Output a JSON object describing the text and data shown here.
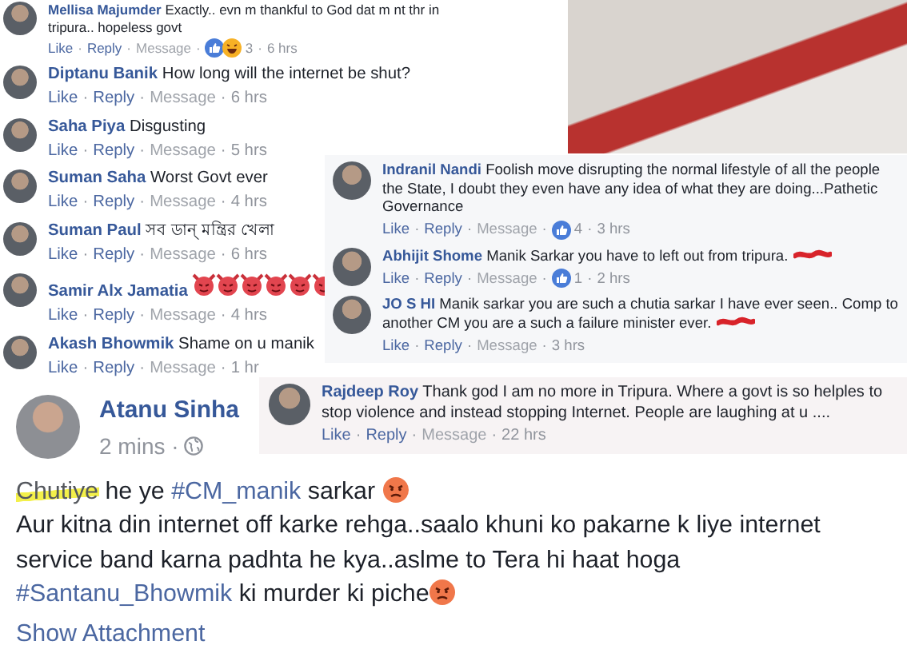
{
  "panels": [
    {
      "kind": "column",
      "comments": [
        {
          "kind": "compact",
          "name": "Mellisa Majumder",
          "text": "Exactly.. evn m thankful to God dat m nt thr in tripura.. hopeless govt",
          "redacted": false,
          "footer": [
            {
              "kind": "link",
              "text": "Like"
            },
            {
              "kind": "sep",
              "text": "·"
            },
            {
              "kind": "link",
              "text": "Reply"
            },
            {
              "kind": "sep",
              "text": "·"
            },
            {
              "kind": "muted",
              "text": "Message"
            },
            {
              "kind": "sep",
              "text": "·"
            },
            {
              "kind": "reaction",
              "haha": true,
              "text": "3"
            },
            {
              "kind": "sep",
              "text": "·"
            },
            {
              "kind": "time",
              "text": "6 hrs"
            }
          ]
        },
        {
          "kind": "normal",
          "name": "Diptanu Banik",
          "text": "How long will the internet be shut?",
          "redacted": false,
          "footer": [
            {
              "kind": "link",
              "text": "Like"
            },
            {
              "kind": "sep",
              "text": "·"
            },
            {
              "kind": "link",
              "text": "Reply"
            },
            {
              "kind": "sep",
              "text": "·"
            },
            {
              "kind": "muted",
              "text": "Message"
            },
            {
              "kind": "sep",
              "text": "·"
            },
            {
              "kind": "time",
              "text": "6 hrs"
            }
          ]
        },
        {
          "kind": "normal",
          "name": "Saha Piya",
          "text": "Disgusting",
          "redacted": false,
          "footer": [
            {
              "kind": "link",
              "text": "Like"
            },
            {
              "kind": "sep",
              "text": "·"
            },
            {
              "kind": "link",
              "text": "Reply"
            },
            {
              "kind": "sep",
              "text": "·"
            },
            {
              "kind": "muted",
              "text": "Message"
            },
            {
              "kind": "sep",
              "text": "·"
            },
            {
              "kind": "time",
              "text": "5 hrs"
            }
          ]
        },
        {
          "kind": "normal",
          "name": "Suman Saha",
          "text": "Worst Govt ever",
          "redacted": false,
          "footer": [
            {
              "kind": "link",
              "text": "Like"
            },
            {
              "kind": "sep",
              "text": "·"
            },
            {
              "kind": "link",
              "text": "Reply"
            },
            {
              "kind": "sep",
              "text": "·"
            },
            {
              "kind": "muted",
              "text": "Message"
            },
            {
              "kind": "sep",
              "text": "·"
            },
            {
              "kind": "time",
              "text": "4 hrs"
            }
          ]
        },
        {
          "kind": "normal",
          "name": "Suman Paul",
          "text": "সব ডান্ মন্ত্রির খেলা",
          "redacted": false,
          "footer": [
            {
              "kind": "link",
              "text": "Like"
            },
            {
              "kind": "sep",
              "text": "·"
            },
            {
              "kind": "link",
              "text": "Reply"
            },
            {
              "kind": "sep",
              "text": "·"
            },
            {
              "kind": "muted",
              "text": "Message"
            },
            {
              "kind": "sep",
              "text": "·"
            },
            {
              "kind": "time",
              "text": "6 hrs"
            }
          ]
        },
        {
          "kind": "devil_emojis",
          "name": "Samir Alx Jamatia",
          "redacted": false,
          "footer": [
            {
              "kind": "link",
              "text": "Like"
            },
            {
              "kind": "sep",
              "text": "·"
            },
            {
              "kind": "link",
              "text": "Reply"
            },
            {
              "kind": "sep",
              "text": "·"
            },
            {
              "kind": "muted",
              "text": "Message"
            },
            {
              "kind": "sep",
              "text": "·"
            },
            {
              "kind": "time",
              "text": "4 hrs"
            }
          ]
        },
        {
          "kind": "normal",
          "name": "Akash Bhowmik",
          "text": "Shame on u manik",
          "redacted": false,
          "footer": [
            {
              "kind": "link",
              "text": "Like"
            },
            {
              "kind": "sep",
              "text": "·"
            },
            {
              "kind": "link",
              "text": "Reply"
            },
            {
              "kind": "sep",
              "text": "·"
            },
            {
              "kind": "muted",
              "text": "Message"
            },
            {
              "kind": "sep",
              "text": "·"
            },
            {
              "kind": "time",
              "text": "1 hr"
            }
          ]
        }
      ]
    },
    {
      "kind": "overlay",
      "comments": [
        {
          "kind": "normal",
          "name": "Indranil Nandi",
          "text": "Foolish move disrupting the normal lifestyle of all the people the State, I doubt they even have any idea of what they are doing...Pathetic Governance",
          "redacted": false,
          "footer": [
            {
              "kind": "link",
              "text": "Like"
            },
            {
              "kind": "sep",
              "text": "·"
            },
            {
              "kind": "link",
              "text": "Reply"
            },
            {
              "kind": "sep",
              "text": "·"
            },
            {
              "kind": "muted",
              "text": "Message"
            },
            {
              "kind": "sep",
              "text": "·"
            },
            {
              "kind": "reaction",
              "haha": false,
              "text": "4"
            },
            {
              "kind": "sep",
              "text": "·"
            },
            {
              "kind": "time",
              "text": "3 hrs"
            }
          ]
        },
        {
          "kind": "normal",
          "name": "Abhijit Shome",
          "text": "Manik Sarkar you have to left out from tripura.",
          "redacted": true,
          "footer": [
            {
              "kind": "link",
              "text": "Like"
            },
            {
              "kind": "sep",
              "text": "·"
            },
            {
              "kind": "link",
              "text": "Reply"
            },
            {
              "kind": "sep",
              "text": "·"
            },
            {
              "kind": "muted",
              "text": "Message"
            },
            {
              "kind": "sep",
              "text": "·"
            },
            {
              "kind": "reaction",
              "haha": false,
              "text": "1"
            },
            {
              "kind": "sep",
              "text": "·"
            },
            {
              "kind": "time",
              "text": "2 hrs"
            }
          ]
        },
        {
          "kind": "normal",
          "name": "JO S HI",
          "text": "Manik sarkar you are such a chutia sarkar I have ever seen.. Comp to another CM you are a such a failure minister ever.",
          "redacted": true,
          "footer": [
            {
              "kind": "link",
              "text": "Like"
            },
            {
              "kind": "sep",
              "text": "·"
            },
            {
              "kind": "link",
              "text": "Reply"
            },
            {
              "kind": "sep",
              "text": "·"
            },
            {
              "kind": "muted",
              "text": "Message"
            },
            {
              "kind": "sep",
              "text": "·"
            },
            {
              "kind": "time",
              "text": "3 hrs"
            }
          ]
        }
      ]
    },
    {
      "kind": "strip",
      "comments": [
        {
          "kind": "normal",
          "name": "Rajdeep Roy",
          "text": "Thank god I am no more in Tripura. Where a govt is so helples to stop violence and instead stopping Internet. People are laughing at u ....",
          "redacted": false,
          "footer": [
            {
              "kind": "link",
              "text": "Like"
            },
            {
              "kind": "sep",
              "text": "·"
            },
            {
              "kind": "link",
              "text": "Reply"
            },
            {
              "kind": "sep",
              "text": "·"
            },
            {
              "kind": "muted",
              "text": "Message"
            },
            {
              "kind": "sep",
              "text": "·"
            },
            {
              "kind": "time",
              "text": "22 hrs"
            }
          ]
        }
      ]
    }
  ],
  "post": {
    "author": "Atanu Sinha",
    "time": "2 mins ·",
    "paragraphs": [
      [
        {
          "kind": "scribbled",
          "text": "Chutiye"
        },
        {
          "kind": "plain",
          "text": " he ye "
        },
        {
          "kind": "hashtag",
          "text": "#CM_manik"
        },
        {
          "kind": "plain",
          "text": " sarkar "
        },
        {
          "kind": "emoji"
        }
      ],
      [
        {
          "kind": "plain",
          "text": "Aur kitna din internet off karke rehga..saalo khuni ko pakarne k liye internet service band karna padhta he kya..aslme to Tera hi haat hoga"
        }
      ],
      [
        {
          "kind": "hashtag",
          "text": "#Santanu_Bhowmik"
        },
        {
          "kind": "plain",
          "text": " ki murder ki piche"
        },
        {
          "kind": "emoji"
        }
      ]
    ],
    "attachment_link": "Show Attachment"
  }
}
